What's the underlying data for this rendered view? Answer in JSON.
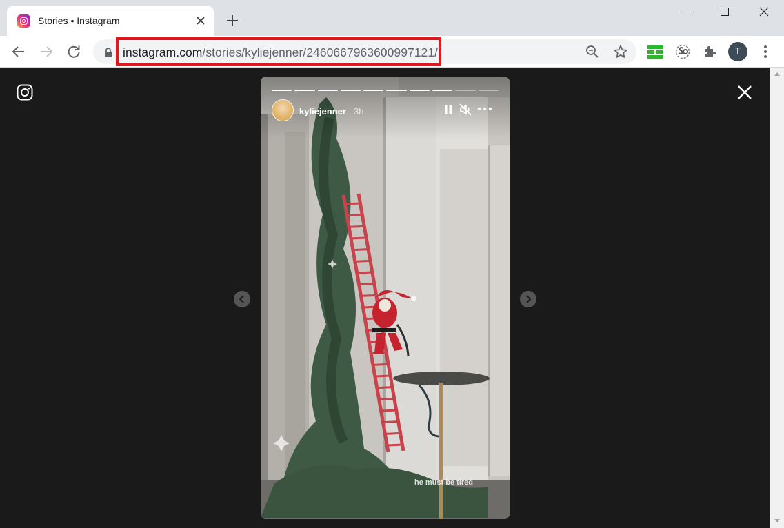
{
  "browser": {
    "tab_title": "Stories • Instagram",
    "url_host": "instagram.com",
    "url_path": "/stories/kyliejenner/2460667963600997121/",
    "profile_initial": "T",
    "icons": {
      "favicon": "instagram-favicon",
      "tab_close": "close-icon",
      "new_tab": "plus-icon",
      "back": "arrow-left-icon",
      "forward": "arrow-right-icon",
      "reload": "reload-icon",
      "lock": "lock-icon",
      "zoom": "zoom-out-icon",
      "bookmark": "star-icon",
      "extension_1": "grid-extension-icon",
      "extension_2": "seo-extension-icon",
      "extensions": "puzzle-icon",
      "menu": "kebab-menu-icon"
    },
    "colors": {
      "url_highlight": "#e8141c",
      "tabstrip": "#dee1e6"
    }
  },
  "story": {
    "username": "kyliejenner",
    "time": "3h",
    "caption": "he must be tired",
    "progress_total": 10,
    "progress_completed": 8,
    "icons": {
      "pause": "pause-icon",
      "mute": "muted-speaker-icon",
      "more": "more-horizontal-icon",
      "prev": "chevron-left-icon",
      "next": "chevron-right-icon",
      "instagram": "instagram-logo-icon",
      "close": "close-icon"
    }
  }
}
